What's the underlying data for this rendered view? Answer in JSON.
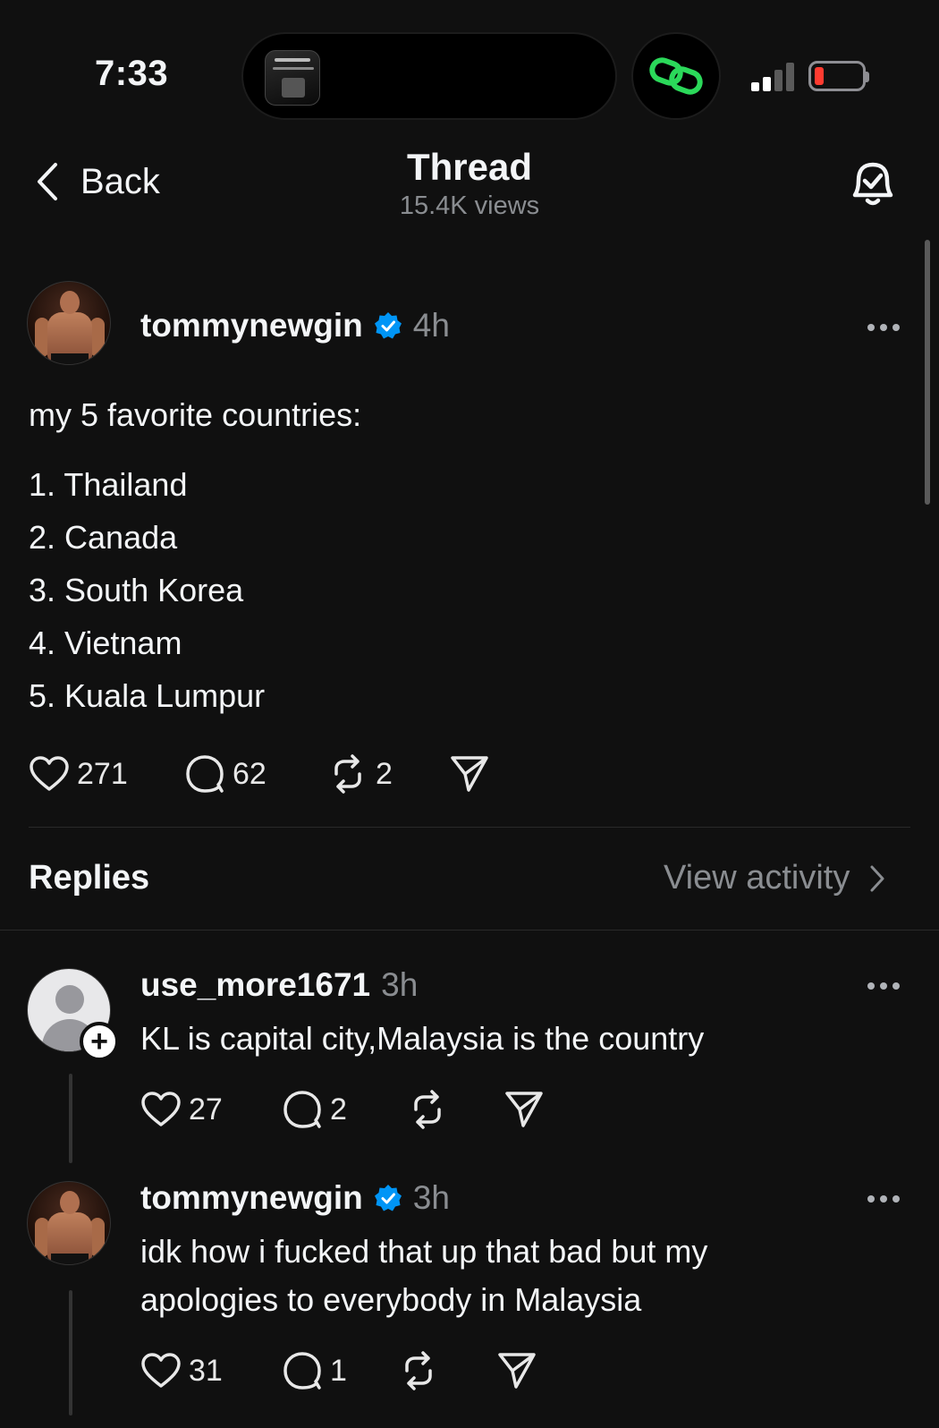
{
  "status_bar": {
    "time": "7:33"
  },
  "header": {
    "back_label": "Back",
    "title": "Thread",
    "views": "15.4K views"
  },
  "post": {
    "username": "tommynewgin",
    "time": "4h",
    "intro": "my 5 favorite countries:",
    "list": [
      "1. Thailand",
      "2. Canada",
      "3. South Korea",
      "4. Vietnam",
      "5. Kuala Lumpur"
    ],
    "likes": "271",
    "comments": "62",
    "reposts": "2"
  },
  "replies_section": {
    "label": "Replies",
    "view_activity": "View activity"
  },
  "replies": [
    {
      "username": "use_more1671",
      "time": "3h",
      "text": "KL is capital city,Malaysia is the country",
      "likes": "27",
      "comments": "2"
    },
    {
      "username": "tommynewgin",
      "time": "3h",
      "text_lines": [
        "idk how i fucked that up that bad but my",
        "apologies to everybody in Malaysia"
      ],
      "likes": "31",
      "comments": "1"
    }
  ],
  "colors": {
    "accent_green": "#2bd95a",
    "verified_blue": "#0095f6",
    "battery_low": "#ff3b30"
  }
}
